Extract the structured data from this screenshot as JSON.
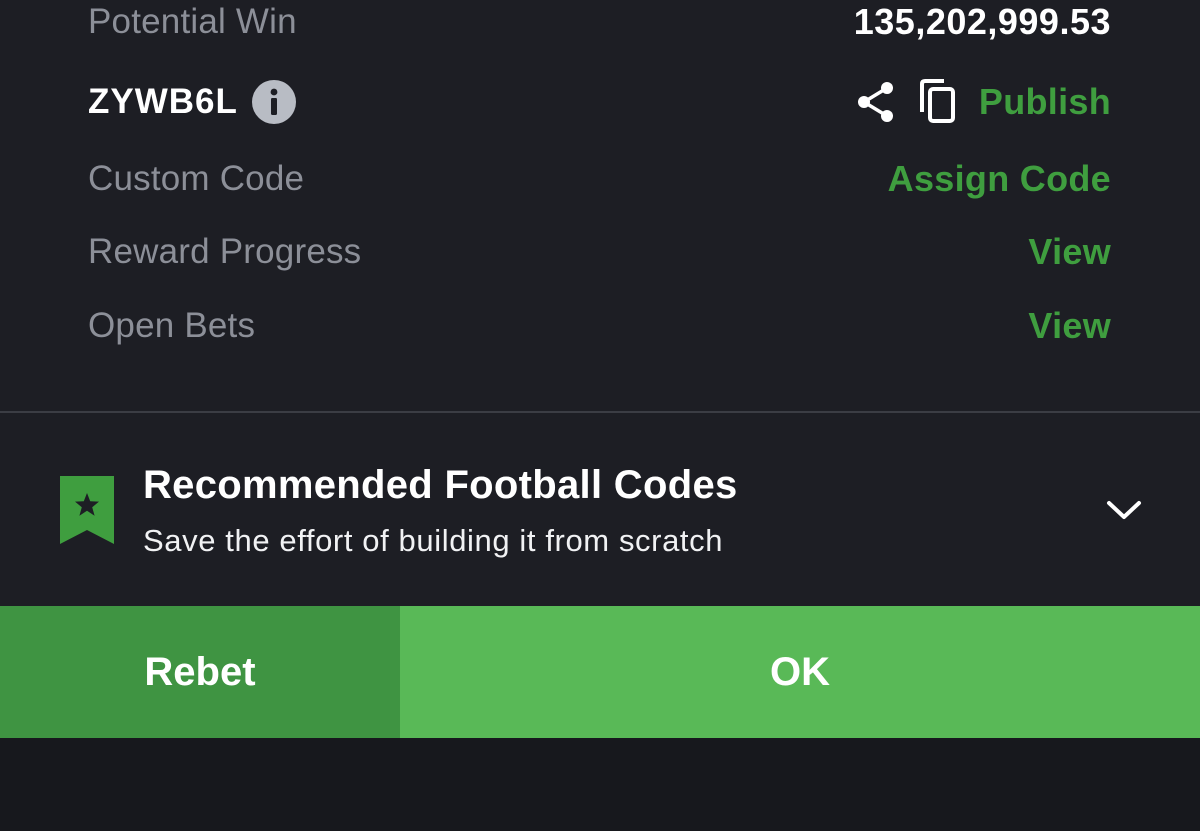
{
  "summary": {
    "potential_win_label": "Potential Win",
    "potential_win_value": "135,202,999.53",
    "booking_code": "ZYWB6L",
    "publish_label": "Publish",
    "custom_code_label": "Custom Code",
    "assign_code_label": "Assign Code",
    "reward_progress_label": "Reward Progress",
    "reward_progress_link": "View",
    "open_bets_label": "Open Bets",
    "open_bets_link": "View"
  },
  "recommended": {
    "title": "Recommended Football Codes",
    "subtitle": "Save the effort of building it from scratch",
    "expanded": false
  },
  "buttons": {
    "rebet_label": "Rebet",
    "ok_label": "OK"
  },
  "icons": {
    "info": "info-icon",
    "share": "share-icon",
    "copy": "copy-icon",
    "bookmark": "bookmark-star-icon",
    "chevron": "chevron-down-icon"
  },
  "colors": {
    "accent_green": "#3f9e3f",
    "rebet_green": "#3f9442",
    "ok_green": "#59b957",
    "panel_bg": "#1d1e24",
    "page_bg": "#17181d",
    "muted_text": "#8c8f98"
  }
}
